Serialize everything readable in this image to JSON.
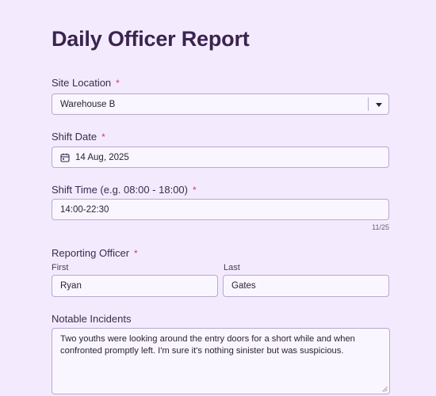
{
  "form": {
    "title": "Daily Officer Report",
    "required_mark": "*",
    "site_location": {
      "label": "Site Location",
      "value": "Warehouse B"
    },
    "shift_date": {
      "label": "Shift Date",
      "value": "14 Aug, 2025"
    },
    "shift_time": {
      "label": "Shift Time (e.g. 08:00 - 18:00)",
      "value": "14:00-22:30",
      "counter": "11/25"
    },
    "reporting_officer": {
      "label": "Reporting Officer",
      "first_label": "First",
      "first_value": "Ryan",
      "last_label": "Last",
      "last_value": "Gates"
    },
    "notable_incidents": {
      "label": "Notable Incidents",
      "value": "Two youths were looking around the entry doors for a short while and when confronted promptly left. I'm sure it's nothing sinister but was suspicious."
    }
  },
  "colors": {
    "background": "#f3ebfd",
    "field_background": "#faf6ff",
    "field_border": "#b9a8cf",
    "required_star": "#d63384",
    "title": "#3a2450"
  }
}
